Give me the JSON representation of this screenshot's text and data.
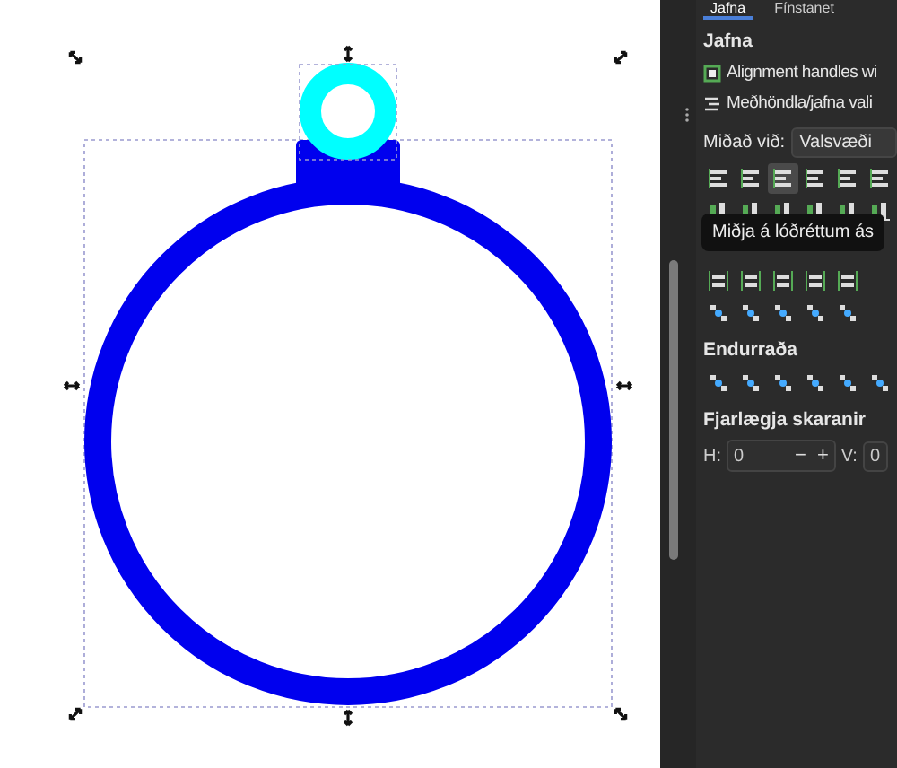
{
  "tabs": [
    {
      "label": "Jafna",
      "selected": true
    },
    {
      "label": "Fínstanet",
      "selected": false
    }
  ],
  "align_section": {
    "heading": "Jafna",
    "options": [
      {
        "kind": "handles",
        "label": "Alignment handles wi"
      },
      {
        "kind": "treat",
        "label": "Meðhöndla/jafna vali"
      }
    ],
    "relative_label": "Miðað við:",
    "relative_value": "Valsvæði",
    "icon_rows": [
      [
        {
          "selected": false
        },
        {
          "selected": false
        },
        {
          "selected": true
        },
        {
          "selected": false
        },
        {
          "selected": false
        },
        {
          "selected": false
        }
      ],
      [
        {
          "selected": false
        },
        {
          "selected": false
        },
        {
          "selected": false
        },
        {
          "selected": false
        },
        {
          "selected": false
        },
        {
          "selected": false
        }
      ],
      [
        {
          "selected": false
        },
        {
          "selected": false
        },
        {
          "selected": false
        },
        {
          "selected": false
        },
        {
          "selected": false
        }
      ],
      [
        {
          "selected": false
        },
        {
          "selected": false
        },
        {
          "selected": false
        },
        {
          "selected": false
        },
        {
          "selected": false
        }
      ]
    ],
    "tooltip": "Miðja á lóðréttum ás"
  },
  "rearrange_section": {
    "heading": "Endurraða",
    "icons": [
      {
        "selected": false
      },
      {
        "selected": false
      },
      {
        "selected": false
      },
      {
        "selected": false
      },
      {
        "selected": false
      },
      {
        "selected": false
      }
    ]
  },
  "overlap_section": {
    "heading": "Fjarlægja skaranir",
    "h_label": "H:",
    "h_value": "0",
    "minus": "−",
    "plus": "+",
    "v_label": "V:",
    "v_value": "0"
  }
}
